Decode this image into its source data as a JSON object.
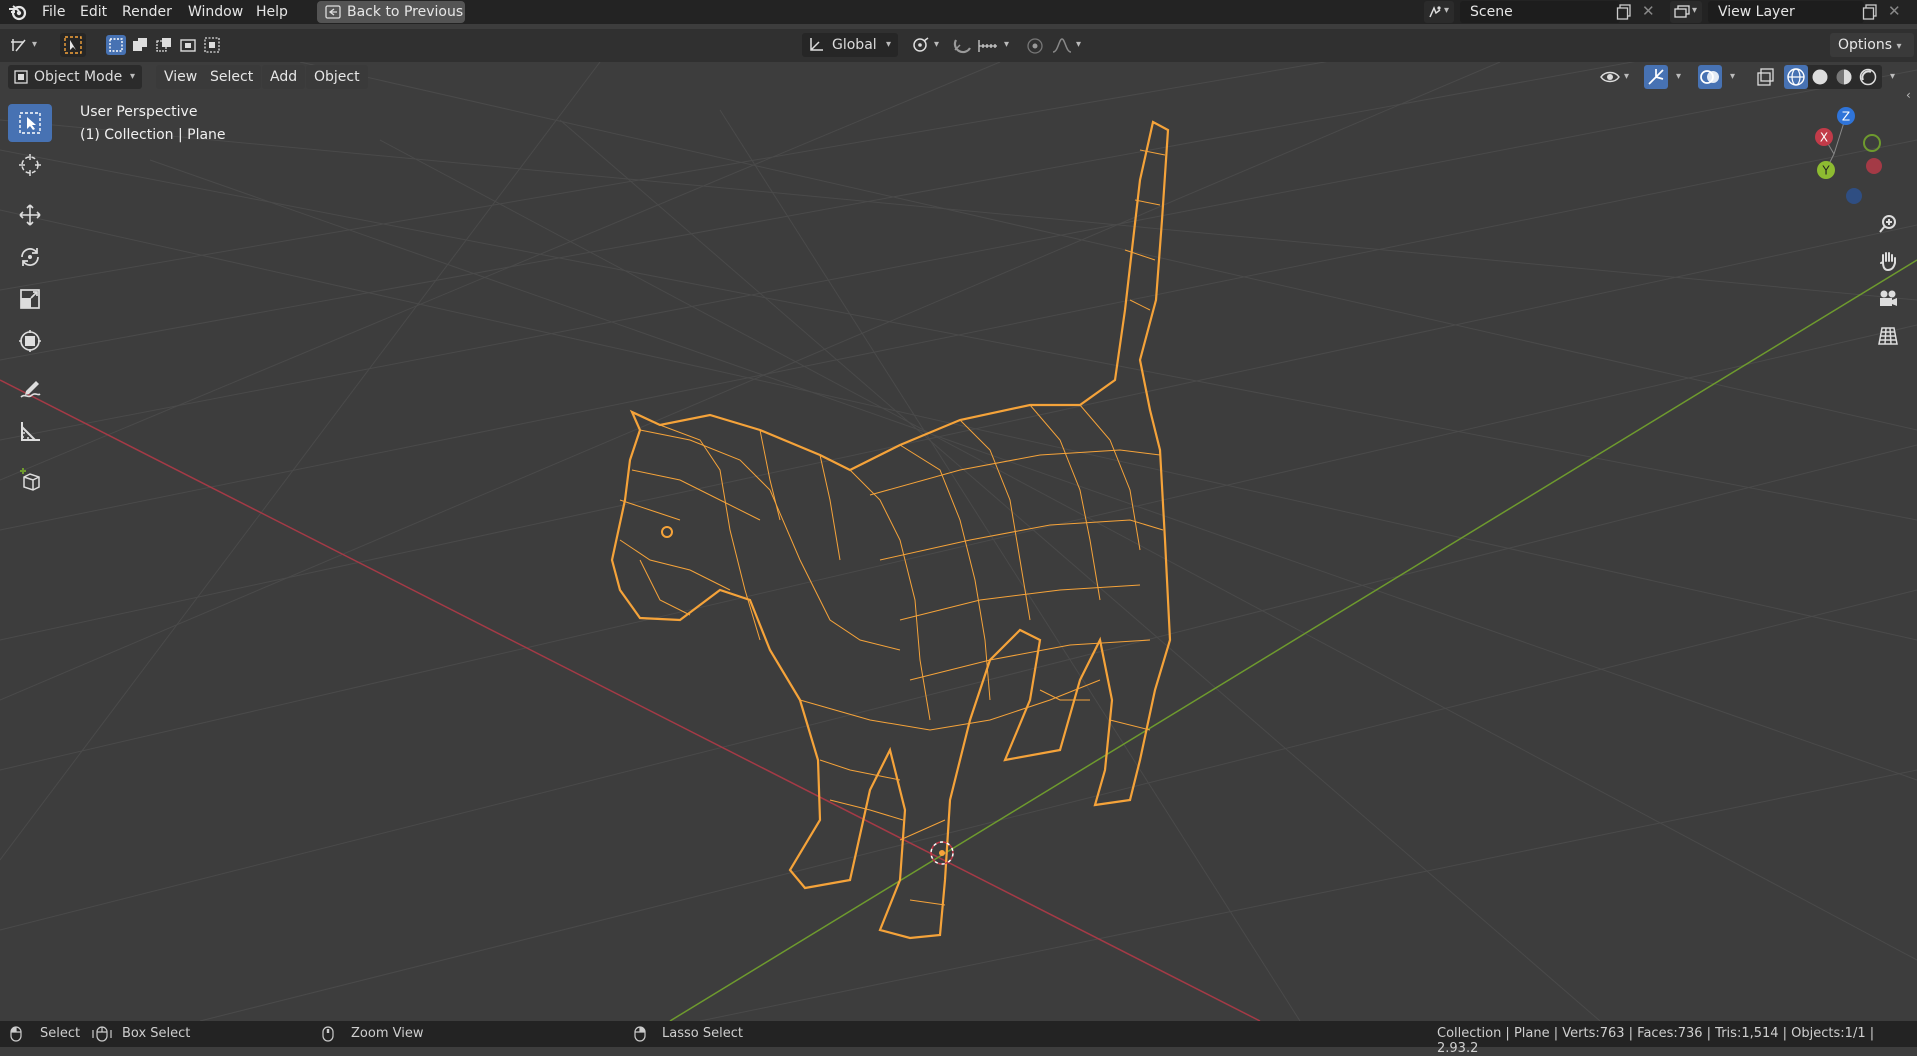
{
  "menu": [
    "File",
    "Edit",
    "Render",
    "Window",
    "Help"
  ],
  "back_button": "Back to Previous",
  "scene": {
    "name": "Scene"
  },
  "view_layer": {
    "name": "View Layer"
  },
  "tool_header": {
    "orientation": "Global",
    "options": "Options"
  },
  "view_header": {
    "mode": "Object Mode",
    "menus": [
      "View",
      "Select",
      "Add",
      "Object"
    ]
  },
  "viewport": {
    "perspective": "User Perspective",
    "collection": "(1) Collection | Plane",
    "gizmo_axes": {
      "x": "X",
      "y": "Y",
      "z": "Z"
    }
  },
  "status": {
    "select": "Select",
    "box_select": "Box Select",
    "zoom_view": "Zoom View",
    "lasso_select": "Lasso Select",
    "stats": "Collection | Plane | Verts:763 | Faces:736 | Tris:1,514 | Objects:1/1 | 2.93.2"
  },
  "colors": {
    "accent": "#4772b3",
    "selection": "#f5a33a",
    "x_axis": "#c23b49",
    "y_axis": "#6e9a2e",
    "z_axis": "#2f74d9"
  }
}
